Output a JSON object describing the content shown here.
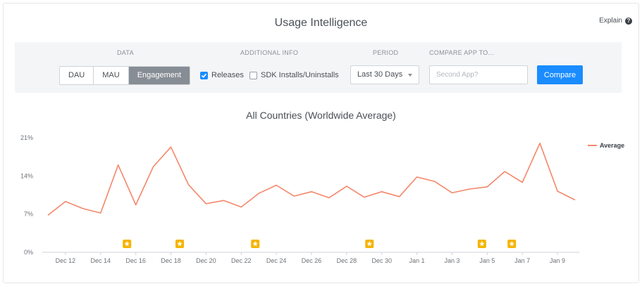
{
  "header": {
    "title": "Usage Intelligence",
    "explain_label": "Explain",
    "explain_icon": "question-circle-icon"
  },
  "controls": {
    "data_label": "DATA",
    "data_options": [
      "DAU",
      "MAU",
      "Engagement"
    ],
    "data_selected": "Engagement",
    "additional_label": "ADDITIONAL INFO",
    "releases_label": "Releases",
    "releases_checked": true,
    "sdk_label": "SDK Installs/Uninstalls",
    "sdk_checked": false,
    "period_label": "PERIOD",
    "period_value": "Last 30 Days",
    "compare_label": "COMPARE APP TO...",
    "compare_placeholder": "Second App?",
    "compare_button": "Compare"
  },
  "colors": {
    "accent": "#1a8cff",
    "series": "#f4876a",
    "release_marker": "#f5b400",
    "segment_active": "#878d95"
  },
  "chart_data": {
    "type": "line",
    "title": "All Countries (Worldwide Average)",
    "x_tick_labels": [
      "Dec 12",
      "Dec 14",
      "Dec 16",
      "Dec 18",
      "Dec 20",
      "Dec 22",
      "Dec 24",
      "Dec 26",
      "Dec 28",
      "Dec 30",
      "Jan 1",
      "Jan 3",
      "Jan 5",
      "Jan 7",
      "Jan 9"
    ],
    "y_tick_labels": [
      "0%",
      "7%",
      "14%",
      "21%"
    ],
    "ylim": [
      0,
      21
    ],
    "series": [
      {
        "name": "Average",
        "values": [
          6.8,
          9.3,
          8.0,
          7.2,
          16.0,
          8.7,
          15.7,
          19.3,
          12.4,
          8.9,
          9.5,
          8.3,
          10.8,
          12.3,
          10.3,
          11.1,
          10.0,
          12.1,
          10.1,
          11.1,
          10.2,
          13.8,
          13.0,
          10.9,
          11.6,
          12.0,
          14.8,
          12.8,
          20.0,
          11.2,
          9.6
        ]
      }
    ],
    "release_markers": [
      4.5,
      7.5,
      11.8,
      18.3,
      24.7,
      26.4
    ],
    "legend_position": "top-right",
    "grid": false
  }
}
